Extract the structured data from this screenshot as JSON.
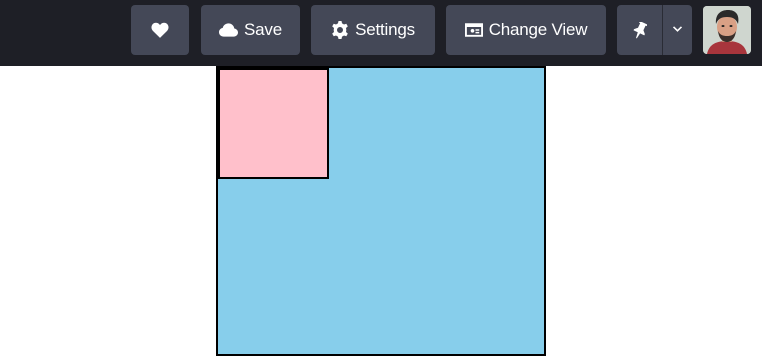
{
  "toolbar": {
    "heart_icon": "heart-icon",
    "save_label": "Save",
    "save_icon": "cloud-icon",
    "settings_label": "Settings",
    "settings_icon": "gear-icon",
    "change_view_label": "Change View",
    "change_view_icon": "window-icon",
    "pin_icon": "pin-icon",
    "dropdown_icon": "chevron-down-icon"
  },
  "avatar": {
    "kind": "user-photo"
  },
  "colors": {
    "topbar_bg": "#1e1f26",
    "button_bg": "#444857",
    "outer_box": "#87ceeb",
    "inner_box": "#ffc0cb",
    "border": "#000000"
  }
}
